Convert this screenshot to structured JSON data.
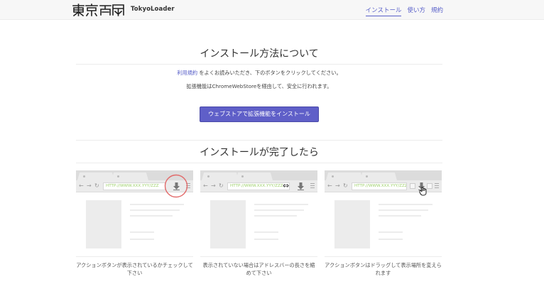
{
  "brand": {
    "name": "TokyoLoader"
  },
  "nav": {
    "items": [
      {
        "label": "インストール"
      },
      {
        "label": "使い方"
      },
      {
        "label": "規約"
      }
    ]
  },
  "main": {
    "install_title": "インストール方法について",
    "terms_link": "利用規約",
    "para1_rest": "をよくお読みいただき、下のボタンをクリックしてください。",
    "para2": "拡張機能はChromeWebStoreを経由して、安全に行われます。",
    "install_button": "ウェブストアで拡張機能をインストール",
    "done_title": "インストールが完了したら"
  },
  "mockups": [
    {
      "url": "HTTP://WWW.XXX.YYY/ZZZ",
      "caption": "アクションボタンが表示されているかチェックして下さい"
    },
    {
      "url": "HTTP://WWW.XXX.YYY/ZZZ",
      "caption": "表示されていない場合はアドレスバーの長さを縮めて下さい"
    },
    {
      "url": "HTTP://WWW.XXX.YYY/ZZZ",
      "caption": "アクションボタンはドラッグして表示場所を変えられます"
    }
  ],
  "colors": {
    "accent": "#5960c9",
    "button": "#5f5fc8",
    "highlight_ring": "#e26a6a",
    "url_text": "#9ccf6a"
  }
}
